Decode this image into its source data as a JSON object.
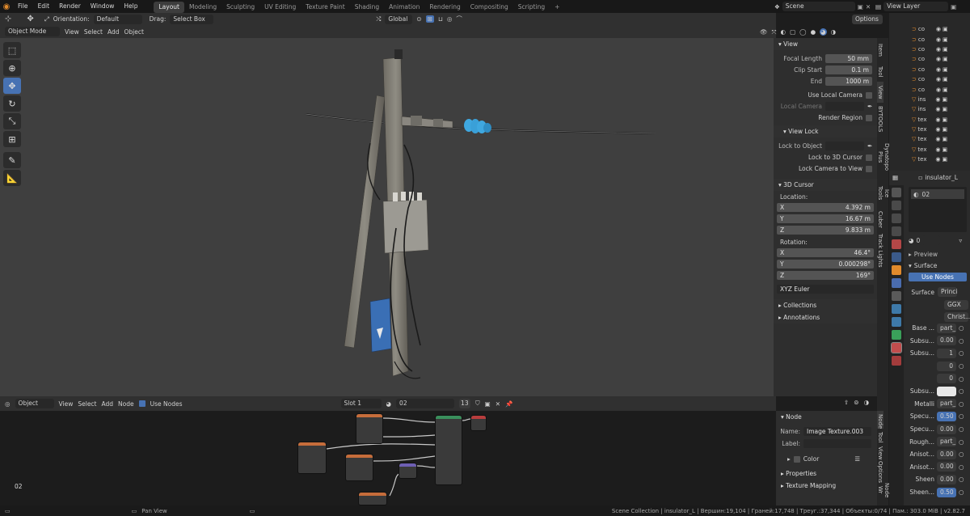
{
  "topbar": {
    "menus": [
      "File",
      "Edit",
      "Render",
      "Window",
      "Help"
    ],
    "workspaces": [
      "Layout",
      "Modeling",
      "Sculpting",
      "UV Editing",
      "Texture Paint",
      "Shading",
      "Animation",
      "Rendering",
      "Compositing",
      "Scripting"
    ],
    "add_tab": "+",
    "scene": "Scene",
    "view_layer": "View Layer"
  },
  "header3d": {
    "orientation_label": "Orientation:",
    "orientation_value": "Default",
    "drag_label": "Drag:",
    "drag_value": "Select Box",
    "transform_space": "Global",
    "options": "Options",
    "mode": "Object Mode",
    "menus": [
      "View",
      "Select",
      "Add",
      "Object"
    ]
  },
  "npanel": {
    "view_title": "View",
    "focal_length_label": "Focal Length",
    "focal_length": "50 mm",
    "clip_start_label": "Clip Start",
    "clip_start": "0.1 m",
    "end_label": "End",
    "end": "1000 m",
    "use_local_camera": "Use Local Camera",
    "local_camera": "Local Camera",
    "render_region": "Render Region",
    "view_lock_title": "View Lock",
    "lock_to_object": "Lock to Object",
    "lock_to_cursor": "Lock to 3D Cursor",
    "lock_camera": "Lock Camera to View",
    "cursor_title": "3D Cursor",
    "location_label": "Location:",
    "loc_x": "4.392 m",
    "loc_y": "16.67 m",
    "loc_z": "9.833 m",
    "rotation_label": "Rotation:",
    "rot_x": "46.4°",
    "rot_y": "0.000298°",
    "rot_z": "169°",
    "rotation_mode": "XYZ Euler",
    "collections": "Collections",
    "annotations": "Annotations",
    "axis_x": "X",
    "axis_y": "Y",
    "axis_z": "Z"
  },
  "vtabs": [
    "Item",
    "Tool",
    "View",
    "BYTOOLS",
    "Dynatopo Plus",
    "Ice Tools",
    "Cuber",
    "Track Lights"
  ],
  "outliner": {
    "rows": [
      {
        "name": "co",
        "kind": "curve"
      },
      {
        "name": "co",
        "kind": "curve"
      },
      {
        "name": "co",
        "kind": "curve"
      },
      {
        "name": "co",
        "kind": "curve"
      },
      {
        "name": "co",
        "kind": "curve"
      },
      {
        "name": "co",
        "kind": "curve"
      },
      {
        "name": "co",
        "kind": "curve"
      },
      {
        "name": "ins",
        "kind": "mesh"
      },
      {
        "name": "ins",
        "kind": "mesh"
      },
      {
        "name": "tex",
        "kind": "mesh"
      },
      {
        "name": "tex",
        "kind": "mesh"
      },
      {
        "name": "tex",
        "kind": "mesh"
      },
      {
        "name": "tex",
        "kind": "mesh"
      },
      {
        "name": "tex",
        "kind": "mesh"
      }
    ]
  },
  "props": {
    "object_name": "insulator_L",
    "material_name": "02",
    "users": "0",
    "preview": "Preview",
    "surface_section": "Surface",
    "use_nodes": "Use Nodes",
    "surface_label": "Surface",
    "surface_value": "Princi",
    "distribution": "GGX",
    "subsurface_method": "Christ...",
    "rows": [
      {
        "label": "Base ...",
        "value": "part_"
      },
      {
        "label": "Subsu...",
        "value": "0.00"
      },
      {
        "label": "Subsu...",
        "value": "1"
      },
      {
        "label": "",
        "value": "0"
      },
      {
        "label": "",
        "value": "0"
      },
      {
        "label": "Subsu...",
        "value": ""
      },
      {
        "label": "Metalli",
        "value": "part_"
      },
      {
        "label": "Specu...",
        "value": "0.50"
      },
      {
        "label": "Specu...",
        "value": "0.00"
      },
      {
        "label": "Rough...",
        "value": "part_"
      },
      {
        "label": "Anisot...",
        "value": "0.00"
      },
      {
        "label": "Anisot...",
        "value": "0.00"
      },
      {
        "label": "Sheen",
        "value": "0.00"
      },
      {
        "label": "Sheen...",
        "value": "0.50"
      }
    ]
  },
  "nodehdr": {
    "editor_type": "Object",
    "menus": [
      "View",
      "Select",
      "Add",
      "Node"
    ],
    "use_nodes": "Use Nodes",
    "slot": "Slot 1",
    "material": "02",
    "users": "13"
  },
  "nodeeditor": {
    "frame_label": "02"
  },
  "nodepanel": {
    "title": "Node",
    "name_label": "Name:",
    "name_value": "Image Texture.003",
    "label_label": "Label:",
    "color": "Color",
    "properties": "Properties",
    "texture_mapping": "Texture Mapping"
  },
  "nvtabs": [
    "Node",
    "Tool",
    "View",
    "Options",
    "Node Wr"
  ],
  "statusbar": {
    "hint": "Pan View",
    "info": "Scene Collection | insulator_L | Вершин:19,104 | Граней:17,748 | Треуг.:37,344 | Объекты:0/74 | Пам.: 303.0 MiB | v2.82.7"
  },
  "colors": {
    "accent": "#4772b3",
    "orange": "#e08a2c",
    "insulator": "#3fa8e0",
    "box_blue": "#3a6fb5"
  }
}
